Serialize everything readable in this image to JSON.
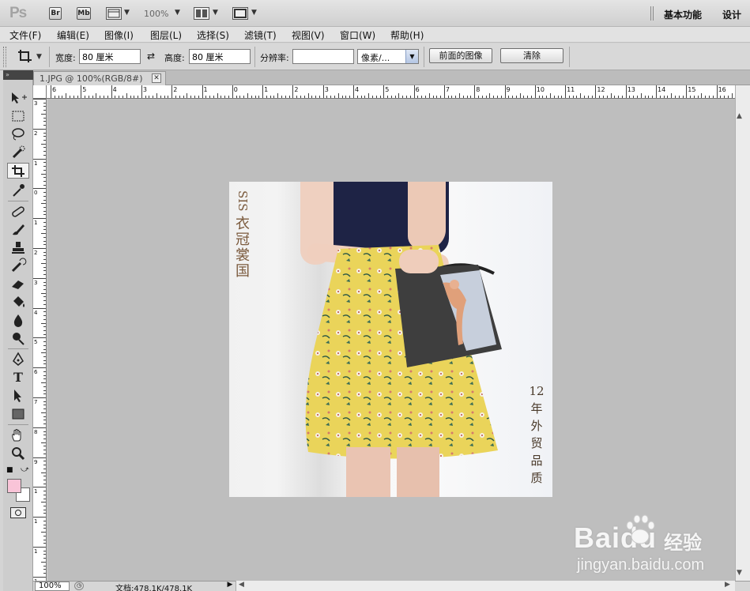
{
  "app": {
    "logo": "Ps",
    "bridge_label": "Br",
    "minibridge_label": "Mb",
    "zoom": "100%",
    "workspace_essentials": "基本功能",
    "workspace_design": "设计"
  },
  "menu": [
    "文件(F)",
    "编辑(E)",
    "图像(I)",
    "图层(L)",
    "选择(S)",
    "滤镜(T)",
    "视图(V)",
    "窗口(W)",
    "帮助(H)"
  ],
  "options": {
    "width_label": "宽度:",
    "width_value": "80 厘米",
    "height_label": "高度:",
    "height_value": "80 厘米",
    "resolution_label": "分辨率:",
    "resolution_value": "",
    "unit_select": "像素/...",
    "front_image_button": "前面的图像",
    "clear_button": "清除"
  },
  "document": {
    "tab_label": "1.JPG @ 100%(RGB/8#)",
    "close_glyph": "✕"
  },
  "rulers": {
    "top": [
      "6",
      "5",
      "4",
      "3",
      "2",
      "1",
      "0",
      "1",
      "2",
      "3",
      "4",
      "5",
      "6",
      "7",
      "8",
      "9",
      "10",
      "11",
      "12",
      "13",
      "14",
      "15",
      "16"
    ],
    "left": [
      "3",
      "2",
      "1",
      "0",
      "1",
      "2",
      "3",
      "4",
      "5",
      "6",
      "7",
      "8",
      "9",
      "1",
      "1",
      "1",
      "1"
    ]
  },
  "photo": {
    "brand_text": [
      "SIS",
      "衣",
      "冠",
      "裳",
      "国"
    ],
    "side_text": [
      "12",
      "年",
      "外",
      "贸",
      "品",
      "质"
    ]
  },
  "colors": {
    "foreground": "#f9c4d8",
    "background": "#ffffff"
  },
  "status": {
    "zoom": "100%",
    "doc_info": "文档:478.1K/478.1K"
  },
  "watermark": {
    "logo_text": "Baidu",
    "cn_text": "经验",
    "url": "jingyan.baidu.com"
  }
}
